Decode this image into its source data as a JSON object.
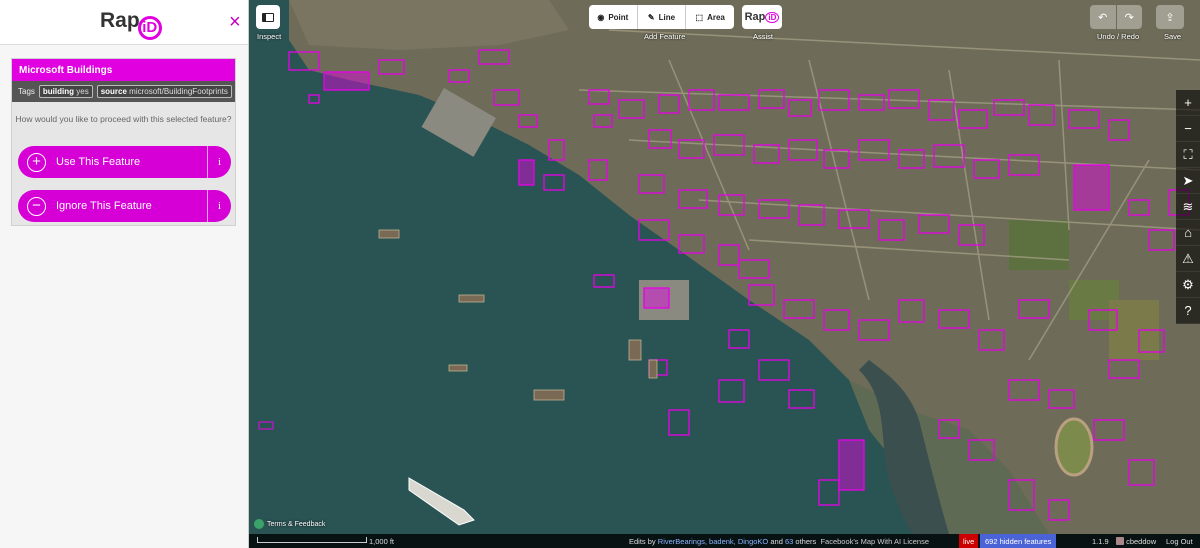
{
  "sidebar": {
    "logo_text": "Rap",
    "logo_mark": "iD",
    "close_icon": "×",
    "panel": {
      "title": "Microsoft Buildings",
      "tags_label": "Tags",
      "tags": [
        {
          "key": "building",
          "value": "yes"
        },
        {
          "key": "source",
          "value": "microsoft/BuildingFootprints"
        }
      ],
      "question": "How would you like to proceed with this selected feature?",
      "use_label": "Use This Feature",
      "ignore_label": "Ignore This Feature",
      "info_glyph": "i"
    }
  },
  "toolbar": {
    "inspect_label": "Inspect",
    "modes": [
      {
        "label": "Point",
        "icon": "pin-icon"
      },
      {
        "label": "Line",
        "icon": "pencil-icon"
      },
      {
        "label": "Area",
        "icon": "area-icon"
      }
    ],
    "add_feature_label": "Add Feature",
    "assist_text": "Rap",
    "assist_mark": "iD",
    "assist_label": "Assist",
    "undo_redo_label": "Undo / Redo",
    "save_label": "Save"
  },
  "map_controls": [
    {
      "name": "zoom-in",
      "glyph": "+"
    },
    {
      "name": "zoom-out",
      "glyph": "−"
    },
    {
      "name": "zoom-to-selection",
      "glyph": "⛶"
    },
    {
      "name": "geolocate",
      "glyph": "➤"
    },
    {
      "name": "background-layers",
      "glyph": "≋"
    },
    {
      "name": "map-data",
      "glyph": "⌂"
    },
    {
      "name": "issues",
      "glyph": "⚠"
    },
    {
      "name": "preferences",
      "glyph": "⚙"
    },
    {
      "name": "help",
      "glyph": "?"
    }
  ],
  "footer": {
    "terms": "Terms & Feedback",
    "scale": "1,000 ft",
    "edits_prefix": "Edits by",
    "editors": "RiverBearings, badenk, DingoKO",
    "and": "and",
    "others_count": "63",
    "others": "others",
    "fb_license": "Facebook's Map With AI License",
    "live": "live",
    "hidden": "692 hidden features",
    "version": "1.1.9",
    "user": "cbeddow",
    "logout": "Log Out"
  },
  "colors": {
    "accent": "#e000e0",
    "water": "#2a5353",
    "land": "#6b6a55",
    "footprint": "#e800e8"
  }
}
